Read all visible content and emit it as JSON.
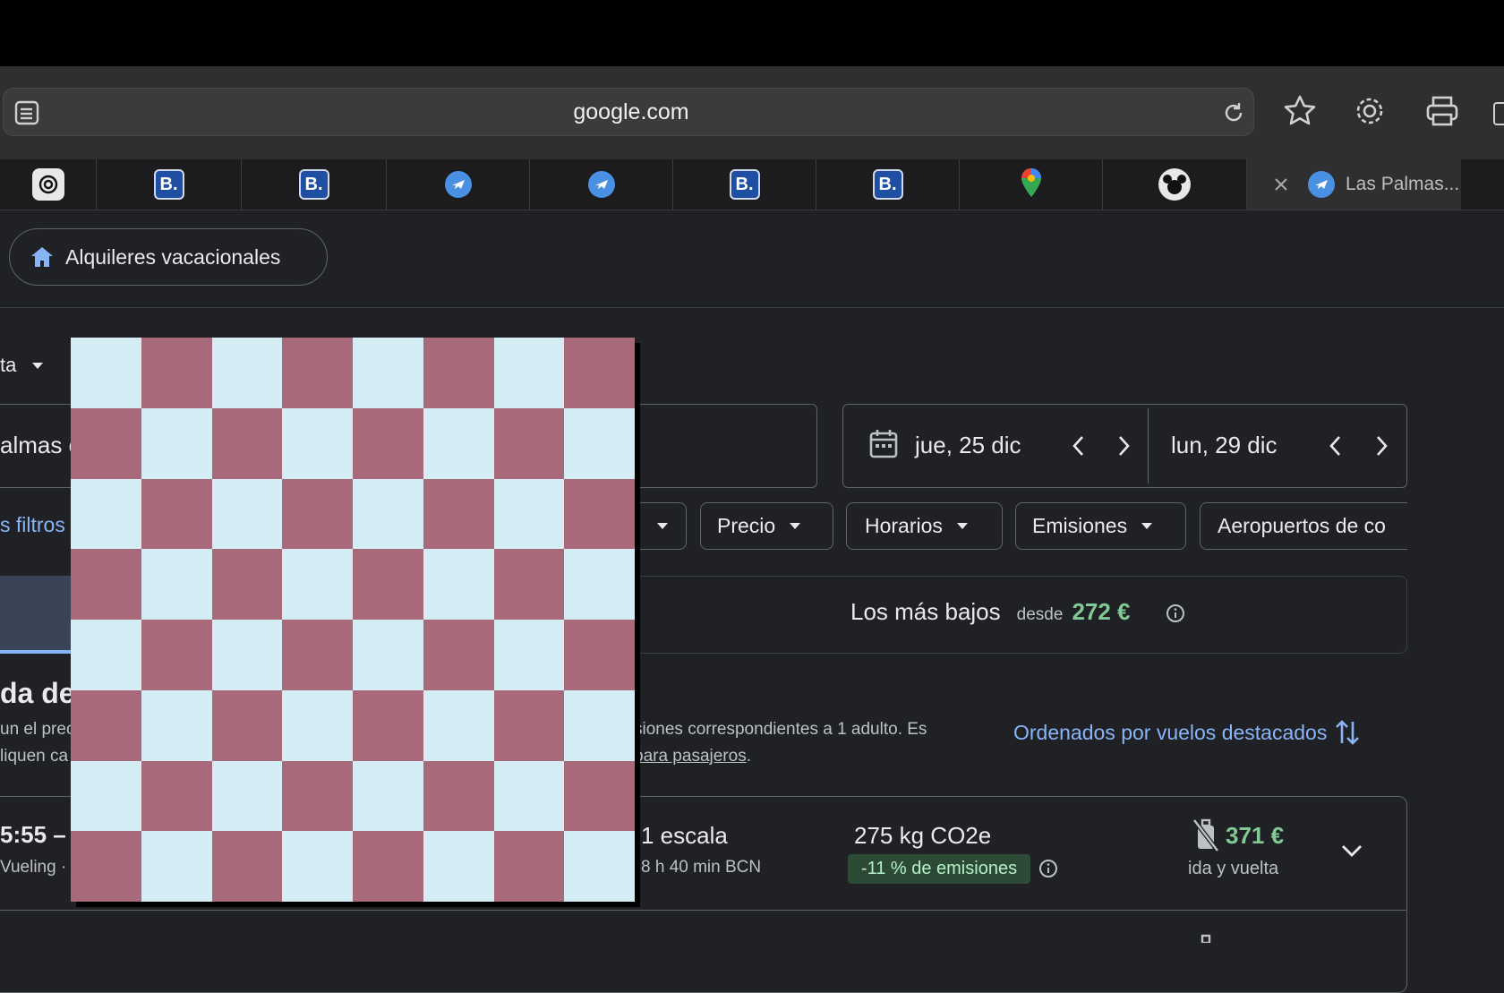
{
  "browser": {
    "url": "google.com",
    "active_tab_title": "Las Palmas..."
  },
  "tabs": [
    {
      "icon": "chatgpt-icon"
    },
    {
      "icon": "booking-icon",
      "letter": "B."
    },
    {
      "icon": "booking-icon",
      "letter": "B."
    },
    {
      "icon": "google-flights-icon"
    },
    {
      "icon": "google-flights-icon"
    },
    {
      "icon": "booking-icon",
      "letter": "B."
    },
    {
      "icon": "booking-icon",
      "letter": "B."
    },
    {
      "icon": "google-maps-icon"
    },
    {
      "icon": "disney-icon"
    }
  ],
  "nav": {
    "rentals_label": "Alquileres vacacionales"
  },
  "search": {
    "trip_type_partial": "ta",
    "origin_partial": "almas c",
    "depart_date": "jue, 25 dic",
    "return_date": "lun, 29 dic"
  },
  "filters": {
    "all_filters_partial": "s filtros",
    "chips": [
      "Precio",
      "Horarios",
      "Emisiones",
      "Aeropuertos de co"
    ]
  },
  "sort_tabs": {
    "cheapest_label": "Los más bajos",
    "cheapest_from": "desde",
    "cheapest_price": "272 €"
  },
  "results": {
    "heading_partial": "da de",
    "desc_line1_left": "un el prec",
    "desc_line1_right": "siones correspondientes a 1 adulto. Es",
    "desc_line2_left": "liquen ca",
    "desc_line2_link": "para pasajeros",
    "desc_line2_end": ".",
    "sort_label": "Ordenados por vuelos destacados"
  },
  "flight": {
    "time_partial": "5:55 – 2",
    "airline_partial": "Vueling ·",
    "stops": "1 escala",
    "layover": "8 h 40 min BCN",
    "emissions": "275 kg CO2e",
    "emissions_badge": "-11 % de emisiones",
    "price": "371 €",
    "price_note": "ida y vuelta"
  },
  "colors": {
    "accent_blue": "#8ab4f8",
    "price_green": "#81c995",
    "checker_light": "#d4ecf3",
    "checker_dark": "#a8697b"
  }
}
